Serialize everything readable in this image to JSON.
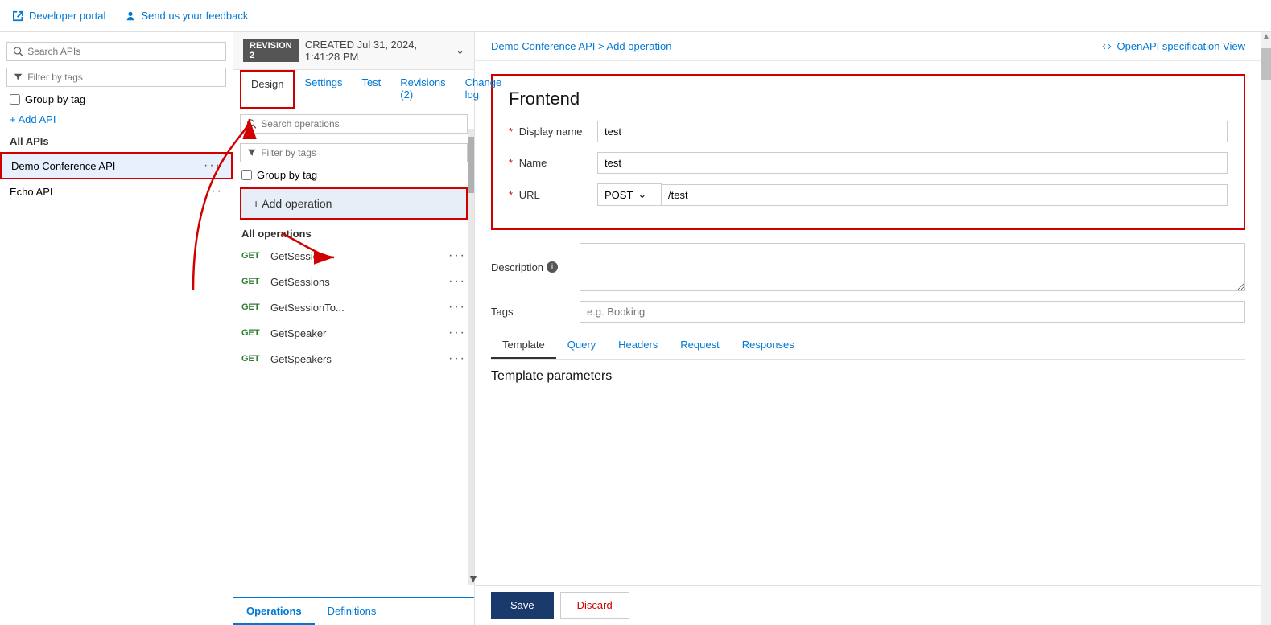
{
  "topbar": {
    "developer_portal_label": "Developer portal",
    "feedback_label": "Send us your feedback"
  },
  "sidebar": {
    "search_placeholder": "Search APIs",
    "filter_placeholder": "Filter by tags",
    "group_by_tag_label": "Group by tag",
    "add_api_label": "+ Add API",
    "all_apis_label": "All APIs",
    "apis": [
      {
        "name": "Demo Conference API",
        "selected": true
      },
      {
        "name": "Echo API",
        "selected": false
      }
    ]
  },
  "center": {
    "revision_badge": "REVISION 2",
    "revision_date": "CREATED Jul 31, 2024, 1:41:28 PM",
    "tabs": [
      {
        "label": "Design",
        "active": true
      },
      {
        "label": "Settings",
        "active": false
      },
      {
        "label": "Test",
        "active": false
      },
      {
        "label": "Revisions (2)",
        "active": false
      },
      {
        "label": "Change log",
        "active": false
      }
    ],
    "ops_search_placeholder": "Search operations",
    "ops_filter_placeholder": "Filter by tags",
    "ops_group_tag_label": "Group by tag",
    "add_operation_label": "+ Add operation",
    "all_operations_label": "All operations",
    "operations": [
      {
        "method": "GET",
        "name": "GetSession"
      },
      {
        "method": "GET",
        "name": "GetSessions"
      },
      {
        "method": "GET",
        "name": "GetSessionTo..."
      },
      {
        "method": "GET",
        "name": "GetSpeaker"
      },
      {
        "method": "GET",
        "name": "GetSpeakers"
      }
    ],
    "bottom_tabs": [
      {
        "label": "Operations",
        "active": true
      },
      {
        "label": "Definitions",
        "active": false
      }
    ]
  },
  "main": {
    "breadcrumb_api": "Demo Conference API",
    "breadcrumb_separator": ">",
    "breadcrumb_page": "Add operation",
    "openapi_label": "OpenAPI specification View",
    "frontend_title": "Frontend",
    "display_name_label": "Display name",
    "display_name_value": "test",
    "name_label": "Name",
    "name_value": "test",
    "url_label": "URL",
    "url_method": "POST",
    "url_path": "/test",
    "description_label": "Description",
    "description_info": "ℹ",
    "tags_label": "Tags",
    "tags_placeholder": "e.g. Booking",
    "sub_tabs": [
      {
        "label": "Template",
        "active": true
      },
      {
        "label": "Query",
        "active": false
      },
      {
        "label": "Headers",
        "active": false
      },
      {
        "label": "Request",
        "active": false
      },
      {
        "label": "Responses",
        "active": false
      }
    ],
    "template_params_title": "Template parameters",
    "save_label": "Save",
    "discard_label": "Discard",
    "required_star": "*"
  }
}
